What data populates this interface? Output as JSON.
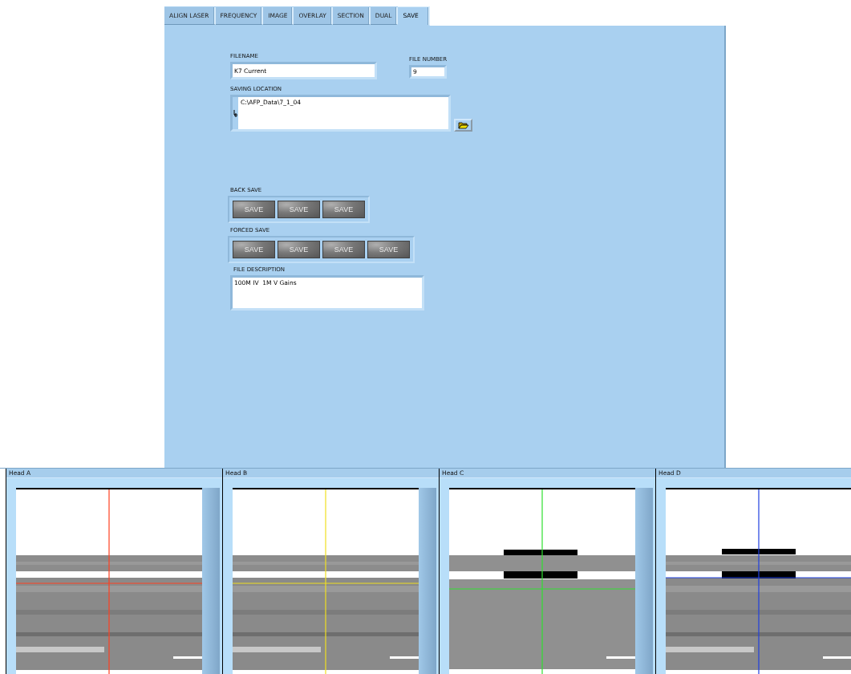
{
  "tabs": [
    {
      "label": "ALIGN LASER",
      "selected": false
    },
    {
      "label": "FREQUENCY",
      "selected": false
    },
    {
      "label": "IMAGE",
      "selected": false
    },
    {
      "label": "OVERLAY",
      "selected": false
    },
    {
      "label": "SECTION",
      "selected": false
    },
    {
      "label": "DUAL",
      "selected": false
    },
    {
      "label": "SAVE",
      "selected": true
    }
  ],
  "filename": {
    "label": "FILENAME",
    "value": "K7 Current"
  },
  "file_number": {
    "label": "FILE NUMBER",
    "value": "9"
  },
  "saving_location": {
    "label": "SAVING LOCATION",
    "value": "C:\\AFP_Data\\7_1_04"
  },
  "back_save": {
    "label": "BACK SAVE",
    "buttons": [
      "SAVE",
      "SAVE",
      "SAVE"
    ]
  },
  "forced_save": {
    "label": "FORCED SAVE",
    "buttons": [
      "SAVE",
      "SAVE",
      "SAVE",
      "SAVE"
    ]
  },
  "file_description": {
    "label": "FILE DESCRIPTION",
    "value": "100M IV  1M V Gains"
  },
  "heads": [
    {
      "title": "Head A"
    },
    {
      "title": "Head B"
    },
    {
      "title": "Head C"
    },
    {
      "title": "Head D"
    }
  ]
}
